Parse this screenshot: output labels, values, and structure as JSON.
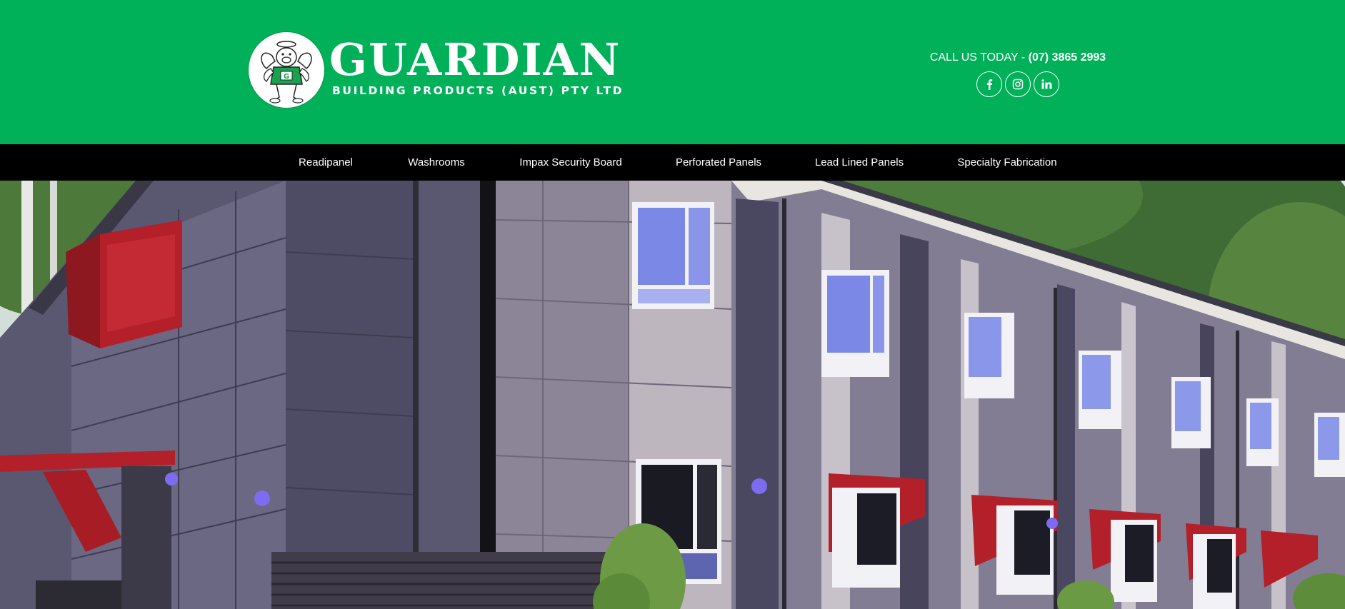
{
  "header": {
    "logo": {
      "name": "GUARDIAN",
      "tagline": "BUILDING PRODUCTS (AUST) PTY LTD"
    },
    "contact": {
      "call_label": "CALL US TODAY - ",
      "phone": "(07) 3865 2993"
    },
    "social": [
      {
        "icon": "facebook-icon"
      },
      {
        "icon": "instagram-icon"
      },
      {
        "icon": "linkedin-icon"
      }
    ]
  },
  "nav": {
    "items": [
      {
        "label": "Readipanel"
      },
      {
        "label": "Washrooms"
      },
      {
        "label": "Impax Security Board"
      },
      {
        "label": "Perforated Panels"
      },
      {
        "label": "Lead Lined Panels"
      },
      {
        "label": "Specialty Fabrication"
      }
    ]
  },
  "hero": {
    "subject": "hero-building-photo"
  },
  "colors": {
    "brand_green": "#00b159",
    "nav_black": "#000000",
    "text_white": "#ffffff",
    "panel_red": "#b3202a"
  }
}
